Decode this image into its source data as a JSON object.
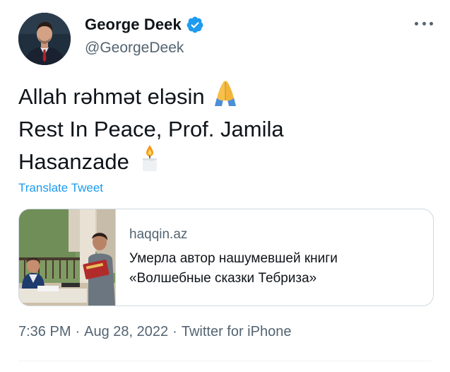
{
  "author": {
    "display_name": "George Deek",
    "handle": "@GeorgeDeek",
    "verified": true,
    "avatar_icon": "profile-photo"
  },
  "more_icon": "more-dots-icon",
  "tweet": {
    "lines": [
      "Allah rəhmət eləsin",
      "Rest In Peace, Prof. Jamila",
      "Hasanzade"
    ],
    "emoji_1": "folded-hands-emoji",
    "emoji_2": "candle-emoji",
    "translate_label": "Translate Tweet"
  },
  "card": {
    "domain": "haqqin.az",
    "title_lines": [
      "Умерла автор нашумевшей книги",
      "«Волшебные сказки Тебриза»"
    ],
    "image_icon": "article-thumbnail"
  },
  "meta": {
    "time": "7:36 PM",
    "separator": "·",
    "date": "Aug 28, 2022",
    "source": "Twitter for iPhone"
  },
  "colors": {
    "link": "#1d9bf0",
    "secondary_text": "#536471",
    "primary_text": "#0f1419",
    "border": "#cfd9de"
  }
}
